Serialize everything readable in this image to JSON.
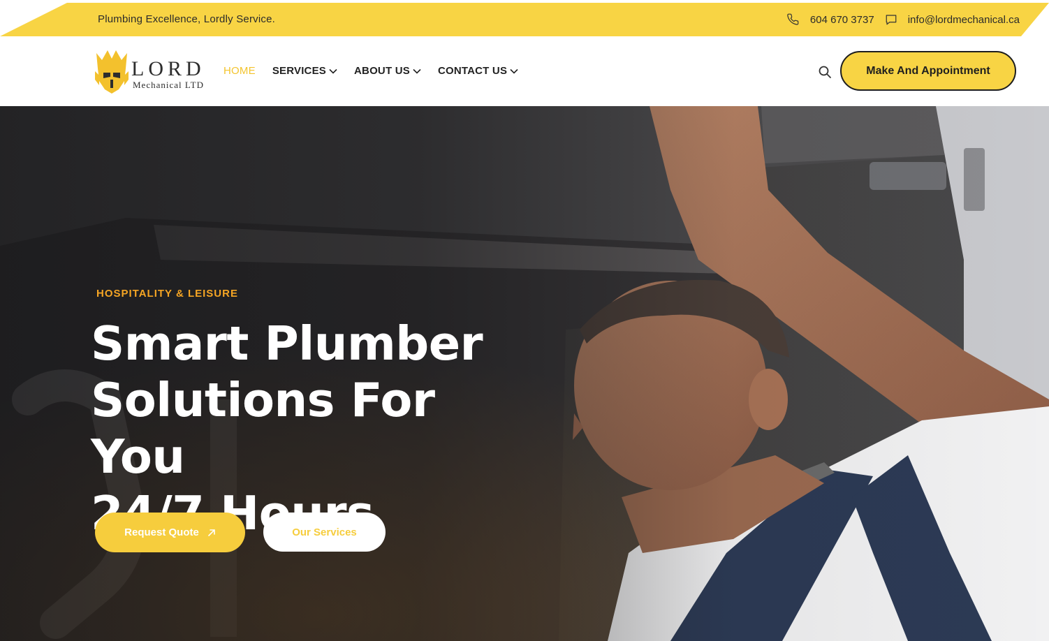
{
  "topbar": {
    "tagline": "Plumbing Excellence, Lordly Service.",
    "phone": "604 670 3737",
    "email": "info@lordmechanical.ca",
    "phone_icon": "phone-icon",
    "email_icon": "chat-icon"
  },
  "logo": {
    "word": "LORD",
    "sub": "Mechanical LTD"
  },
  "nav": {
    "items": [
      {
        "label": "HOME",
        "active": true
      },
      {
        "label": "SERVICES",
        "dropdown": true
      },
      {
        "label": "ABOUT US",
        "dropdown": true
      },
      {
        "label": "CONTACT US",
        "dropdown": true
      }
    ]
  },
  "header": {
    "search_icon": "search-icon",
    "appointment_label": "Make And Appointment"
  },
  "hero": {
    "eyebrow": "HOSPITALITY & LEISURE",
    "headline_line1": "Smart Plumber",
    "headline_line2": "Solutions For You",
    "headline_line3": "24/7 Hours",
    "quote_label": "Request Quote",
    "services_label": "Our Services"
  },
  "colors": {
    "accent": "#f8d444",
    "eyebrow": "#f5a524",
    "dark": "#1e1e1e"
  }
}
